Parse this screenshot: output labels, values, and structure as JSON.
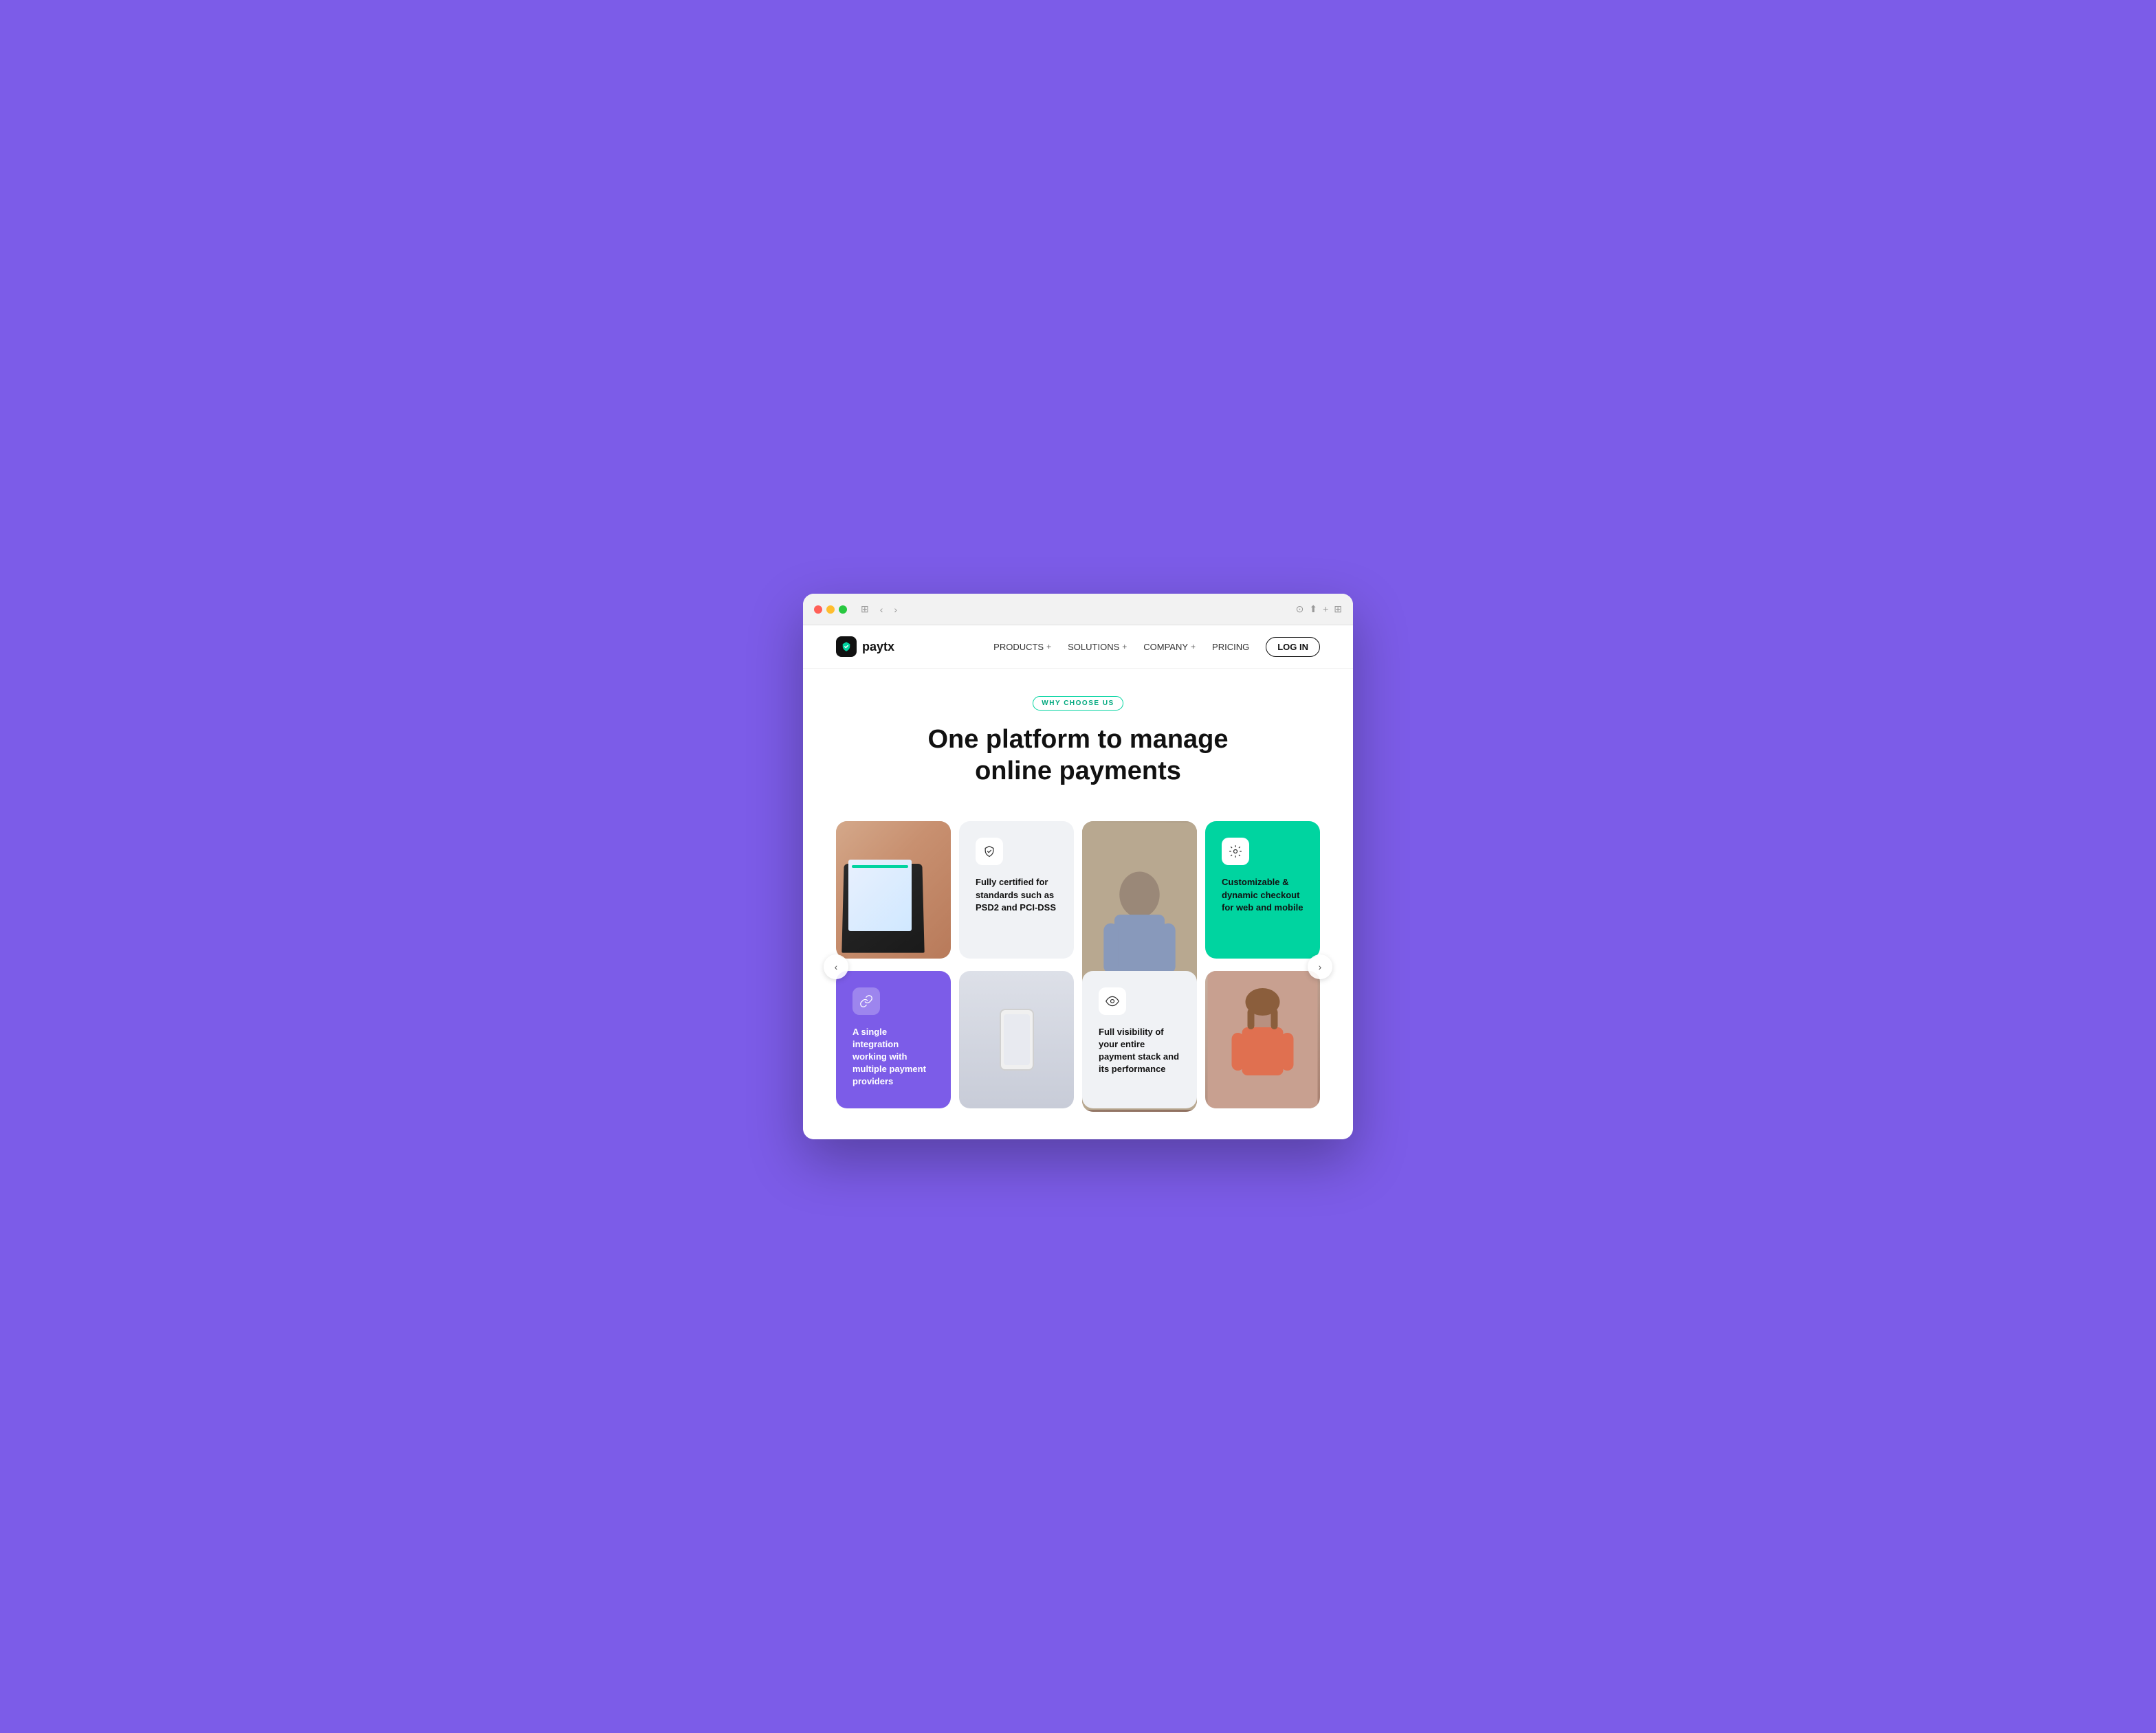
{
  "browser": {
    "dots": [
      "red",
      "yellow",
      "green"
    ],
    "controls": [
      "‹",
      "›"
    ],
    "actions": [
      "⊙",
      "⬆",
      "+",
      "⊞"
    ]
  },
  "nav": {
    "logo_text": "paytx",
    "products_label": "PRODUCTS",
    "solutions_label": "SOLUTIONS",
    "company_label": "COMPANY",
    "pricing_label": "PRICING",
    "login_label": "LOG IN"
  },
  "hero": {
    "badge_text": "WHY CHOOSE US",
    "headline_line1": "One platform to manage",
    "headline_line2": "online payments"
  },
  "cards": {
    "certified_text": "Fully certified for standards such as PSD2 and PCI-DSS",
    "customizable_text": "Customizable & dynamic checkout for web and mobile",
    "integration_text": "A single integration working with multiple payment providers",
    "visibility_text": "Full visibility of your entire payment stack and its performance"
  },
  "colors": {
    "purple": "#7c5ce8",
    "green": "#00d4a0",
    "light_bg": "#f0f2f5",
    "dark": "#111111"
  }
}
